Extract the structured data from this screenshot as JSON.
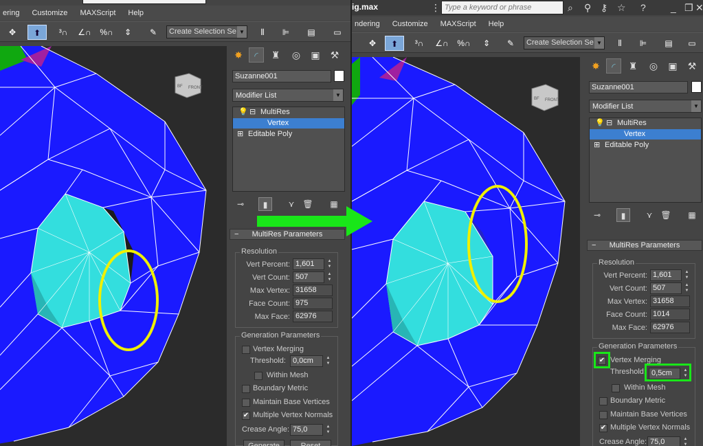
{
  "left": {
    "menu": [
      "ering",
      "Customize",
      "MAXScript",
      "Help"
    ],
    "selection_set": "Create Selection Se",
    "search_partial": "",
    "panel": {
      "object_name": "Suzanne001",
      "modifier_list": "Modifier List",
      "stack": [
        "MultiRes",
        "Vertex",
        "Editable Poly"
      ],
      "rollout": "MultiRes Parameters",
      "resolution_title": "Resolution",
      "resolution": [
        {
          "label": "Vert Percent:",
          "value": "1,601"
        },
        {
          "label": "Vert Count:",
          "value": "507"
        },
        {
          "label": "Max Vertex:",
          "value": "31658"
        },
        {
          "label": "Face Count:",
          "value": "975"
        },
        {
          "label": "Max Face:",
          "value": "62976"
        }
      ],
      "gen_title": "Generation Parameters",
      "vertex_merging": "Vertex Merging",
      "vertex_merging_checked": false,
      "threshold_label": "Threshold:",
      "threshold_value": "0,0cm",
      "within_mesh": "Within Mesh",
      "boundary_metric": "Boundary Metric",
      "maintain_base": "Maintain Base Vertices",
      "multiple_normals": "Multiple Vertex Normals",
      "multiple_normals_checked": true,
      "crease_label": "Crease Angle:",
      "crease_value": "75,0",
      "generate": "Generate",
      "reset": "Reset"
    }
  },
  "right": {
    "title": "ig.max",
    "search_placeholder": "Type a keyword or phrase",
    "menu": [
      "ndering",
      "Customize",
      "MAXScript",
      "Help"
    ],
    "selection_set": "Create Selection Se",
    "panel": {
      "object_name": "Suzanne001",
      "modifier_list": "Modifier List",
      "stack": [
        "MultiRes",
        "Vertex",
        "Editable Poly"
      ],
      "rollout": "MultiRes Parameters",
      "resolution_title": "Resolution",
      "resolution": [
        {
          "label": "Vert Percent:",
          "value": "1,601"
        },
        {
          "label": "Vert Count:",
          "value": "507"
        },
        {
          "label": "Max Vertex:",
          "value": "31658"
        },
        {
          "label": "Face Count:",
          "value": "1014"
        },
        {
          "label": "Max Face:",
          "value": "62976"
        }
      ],
      "gen_title": "Generation Parameters",
      "vertex_merging": "Vertex Merging",
      "vertex_merging_checked": true,
      "threshold_label": "Threshold:",
      "threshold_value": "0,5cm",
      "within_mesh": "Within Mesh",
      "boundary_metric": "Boundary Metric",
      "maintain_base": "Maintain Base Vertices",
      "multiple_normals": "Multiple Vertex Normals",
      "multiple_normals_checked": true,
      "crease_label": "Crease Angle:",
      "crease_value": "75,0"
    }
  },
  "viewcube": {
    "left_face": "BF",
    "right_face": "FRONT"
  },
  "colors": {
    "mesh_blue": "#1a1aff",
    "mesh_cyan": "#33dede",
    "wire": "#ffffff",
    "highlight_yellow": "#f0f000",
    "highlight_green": "#19e619",
    "selection_blue": "#3c7fd0"
  },
  "icons": [
    "move-icon",
    "select-object-icon",
    "snap-3-icon",
    "angle-snap-icon",
    "percent-snap-icon",
    "spinner-snap-icon",
    "edit-named-selection-icon",
    "mirror-icon",
    "align-icon",
    "layer-icon",
    "ribbon-icon",
    "create-tab-icon",
    "modify-tab-icon",
    "hierarchy-tab-icon",
    "motion-tab-icon",
    "display-tab-icon",
    "utilities-tab-icon"
  ]
}
